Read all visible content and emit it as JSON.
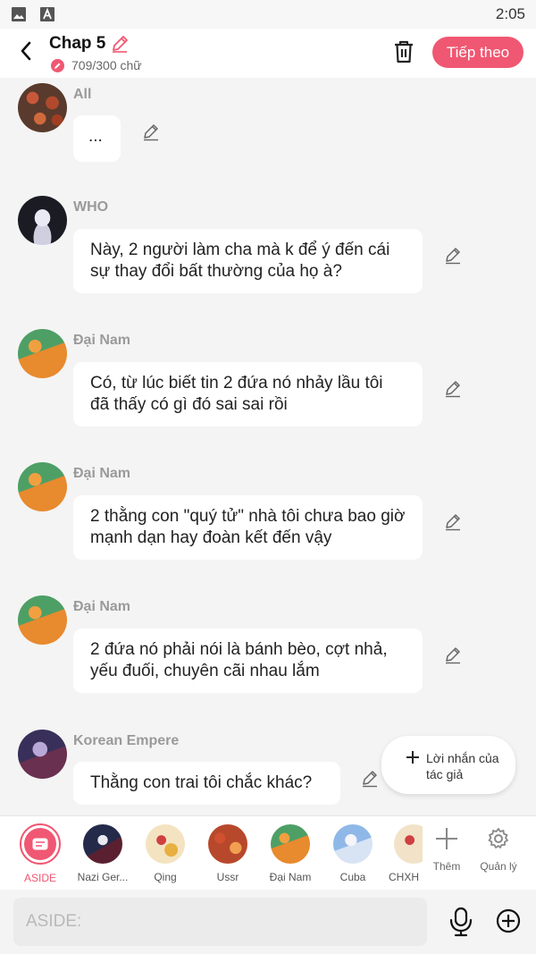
{
  "status_bar": {
    "time": "2:05",
    "icons": [
      "image-icon",
      "text-a-icon"
    ]
  },
  "header": {
    "title": "Chap 5",
    "word_count": "709/300 chữ",
    "next_button": "Tiếp theo"
  },
  "messages": [
    {
      "sender": "All",
      "text": "...",
      "avatar": "avatar-all"
    },
    {
      "sender": "WHO",
      "text": "Này, 2 người làm cha mà k để ý đến cái sự thay đổi bất thường của họ à?",
      "avatar": "avatar-who"
    },
    {
      "sender": "Đại Nam",
      "text": "Có, từ lúc biết tin 2 đứa nó nhảy lầu tôi đã thấy có gì đó sai sai rồi",
      "avatar": "avatar-dai-nam"
    },
    {
      "sender": "Đại Nam",
      "text": "2 thằng con \"quý tử\" nhà tôi chưa bao giờ mạnh dạn hay đoàn kết đến vậy",
      "avatar": "avatar-dai-nam"
    },
    {
      "sender": "Đại Nam",
      "text": "2 đứa nó phải nói là bánh bèo, cợt nhả, yếu đuối, chuyên cãi nhau lắm",
      "avatar": "avatar-dai-nam"
    },
    {
      "sender": "Korean Empere",
      "text": "Thằng con trai tôi chắc khác?",
      "avatar": "avatar-korean"
    }
  ],
  "fab": {
    "label": "Lời nhắn của tác giả"
  },
  "characters": [
    {
      "label": "ASIDE"
    },
    {
      "label": "Nazi Ger..."
    },
    {
      "label": "Qing"
    },
    {
      "label": "Ussr"
    },
    {
      "label": "Đại Nam"
    },
    {
      "label": "Cuba"
    },
    {
      "label": "CHXH"
    }
  ],
  "tools": {
    "add_label": "Thêm",
    "manage_label": "Quản lý"
  },
  "input": {
    "placeholder": "ASIDE:"
  },
  "colors": {
    "accent": "#f05772",
    "background": "#f4f4f4",
    "bubble": "#ffffff"
  }
}
